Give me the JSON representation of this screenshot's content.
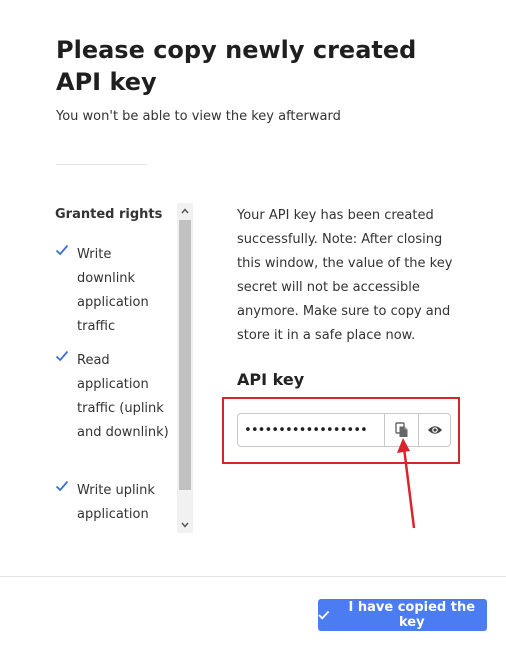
{
  "modal": {
    "title": "Please copy newly created API key",
    "subtitle": "You won't be able to view the key afterward"
  },
  "granted_rights": {
    "title": "Granted rights",
    "items": [
      "Write downlink application traffic",
      "Read application traffic (uplink and downlink)",
      "Write uplink application"
    ]
  },
  "info": {
    "text": "Your API key has been created successfully. Note: After closing this window, the value of the key secret will not be accessible anymore. Make sure to copy and store it in a safe place now."
  },
  "api_key": {
    "label": "API key",
    "masked_value": "••••••••••••••••••",
    "copy_icon": "copy-icon",
    "show_icon": "eye-icon"
  },
  "footer": {
    "confirm_label": "I have copied the key"
  },
  "colors": {
    "primary": "#4c7cf2",
    "check": "#3b6fd4",
    "annotation": "#d8242c"
  }
}
